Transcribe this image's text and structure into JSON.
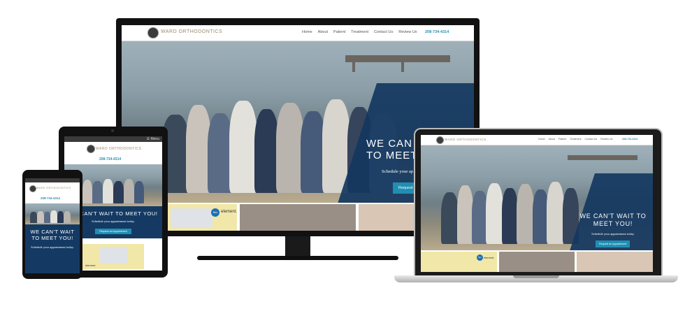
{
  "site": {
    "brand": "WARD ORTHODONTICS",
    "nav": [
      "Home",
      "About",
      "Patient",
      "Treatment",
      "Contact Us",
      "Review Us"
    ],
    "phone": "208-734-4314",
    "menu_label": "Menu",
    "hero_heading_desktop": "WE CAN'T WAIT TO MEET YOU!",
    "hero_heading_partial": "WE CAN",
    "hero_heading_partial2": "TO MEET",
    "hero_sub": "Schedule your appointment today.",
    "hero_sub_partial": "Schedule your ap",
    "cta": "Request an Appointment",
    "cta_partial": "Request ar",
    "tile_brand": "element.",
    "tile_badge": "flex"
  },
  "colors": {
    "accent": "#1f8fb3",
    "hero_blue": "#143a63",
    "brand_gold": "#9a8a6a"
  }
}
